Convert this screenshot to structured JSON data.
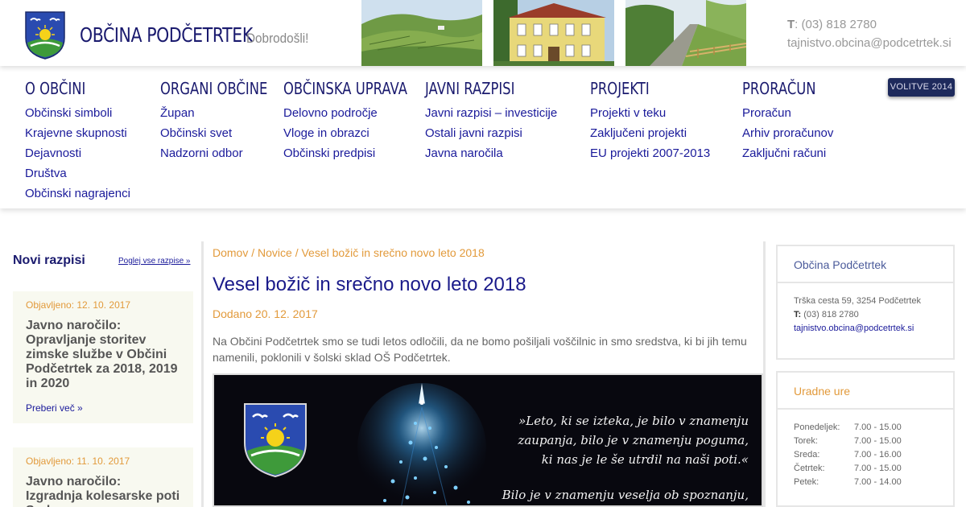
{
  "header": {
    "title": "OBČINA PODČETRTEK",
    "tagline": "Dobrodošli!",
    "phone_label": "T",
    "phone": ": (03) 818 2780",
    "email": "tajnistvo.obcina@podcetrtek.si"
  },
  "menu": [
    {
      "heading": "O OBČINI",
      "links": [
        "Občinski simboli",
        "Krajevne skupnosti",
        "Dejavnosti",
        "Društva",
        "Občinski nagrajenci"
      ]
    },
    {
      "heading": "ORGANI OBČINE",
      "links": [
        "Župan",
        "Občinski svet",
        "Nadzorni odbor"
      ]
    },
    {
      "heading": "OBČINSKA UPRAVA",
      "links": [
        "Delovno področje",
        "Vloge in obrazci",
        "Občinski predpisi"
      ]
    },
    {
      "heading": "JAVNI RAZPISI",
      "links": [
        "Javni razpisi – investicije",
        "Ostali javni razpisi",
        "Javna naročila"
      ]
    },
    {
      "heading": "PROJEKTI",
      "links": [
        "Projekti v teku",
        "Zaključeni projekti",
        "EU projekti 2007-2013"
      ]
    },
    {
      "heading": "PRORAČUN",
      "links": [
        "Proračun",
        "Arhiv proračunov",
        "Zaključni računi"
      ]
    }
  ],
  "volitve_button": "VOLITVE 2014",
  "sidebar": {
    "title": "Novi razpisi",
    "view_all": "Poglej vse razpise »",
    "items": [
      {
        "date": "Objavljeno: 12. 10. 2017",
        "title": "Javno naročilo: Opravljanje storitev zimske službe v Občini Podčetrtek za 2018, 2019 in 2020",
        "more": "Preberi več »"
      },
      {
        "date": "Objavljeno: 11. 10. 2017",
        "title": "Javno naročilo: Izgradnja kolesarske poti Sodna",
        "more": ""
      }
    ]
  },
  "article": {
    "breadcrumb": "Domov / Novice / Vesel božič in srečno novo leto 2018",
    "title": "Vesel božič in srečno novo leto 2018",
    "date": "Dodano 20. 12. 2017",
    "body": "Na Občini Podčetrtek smo se tudi letos odločili, da ne bomo pošiljali voščilnic in smo sredstva, ki bi jih temu namenili, poklonili v šolski sklad OŠ Podčetrtek.",
    "image_quote": [
      "»Leto, ki se izteka, je bilo v znamenju",
      "zaupanja, bilo je v znamenju poguma,",
      "ki nas je le še utrdil na naši poti.«",
      "Bilo je v znamenju veselja ob spoznanju,"
    ]
  },
  "contact_box": {
    "heading": "Občina Podčetrtek",
    "address": "Trška cesta 59, 3254 Podčetrtek",
    "phone_label": "T:",
    "phone": " (03) 818 2780",
    "email": "tajnistvo.obcina@podcetrtek.si"
  },
  "hours_box": {
    "heading": "Uradne ure",
    "rows": [
      {
        "day": "Ponedeljek:",
        "hours": "7.00 - 15.00"
      },
      {
        "day": "Torek:",
        "hours": "7.00 - 15.00"
      },
      {
        "day": "Sreda:",
        "hours": "7.00 - 16.00"
      },
      {
        "day": "Četrtek:",
        "hours": "7.00 - 15.00"
      },
      {
        "day": "Petek:",
        "hours": "7.00 - 14.00"
      }
    ]
  },
  "colors": {
    "navy": "#1a1a6e",
    "link": "#1a1a9a",
    "orange": "#e29a3b",
    "coat_blue": "#2a4bb0",
    "coat_green": "#3e9a3a",
    "coat_yellow": "#f5d21a"
  },
  "icons": [
    "coat-of-arms-icon"
  ]
}
